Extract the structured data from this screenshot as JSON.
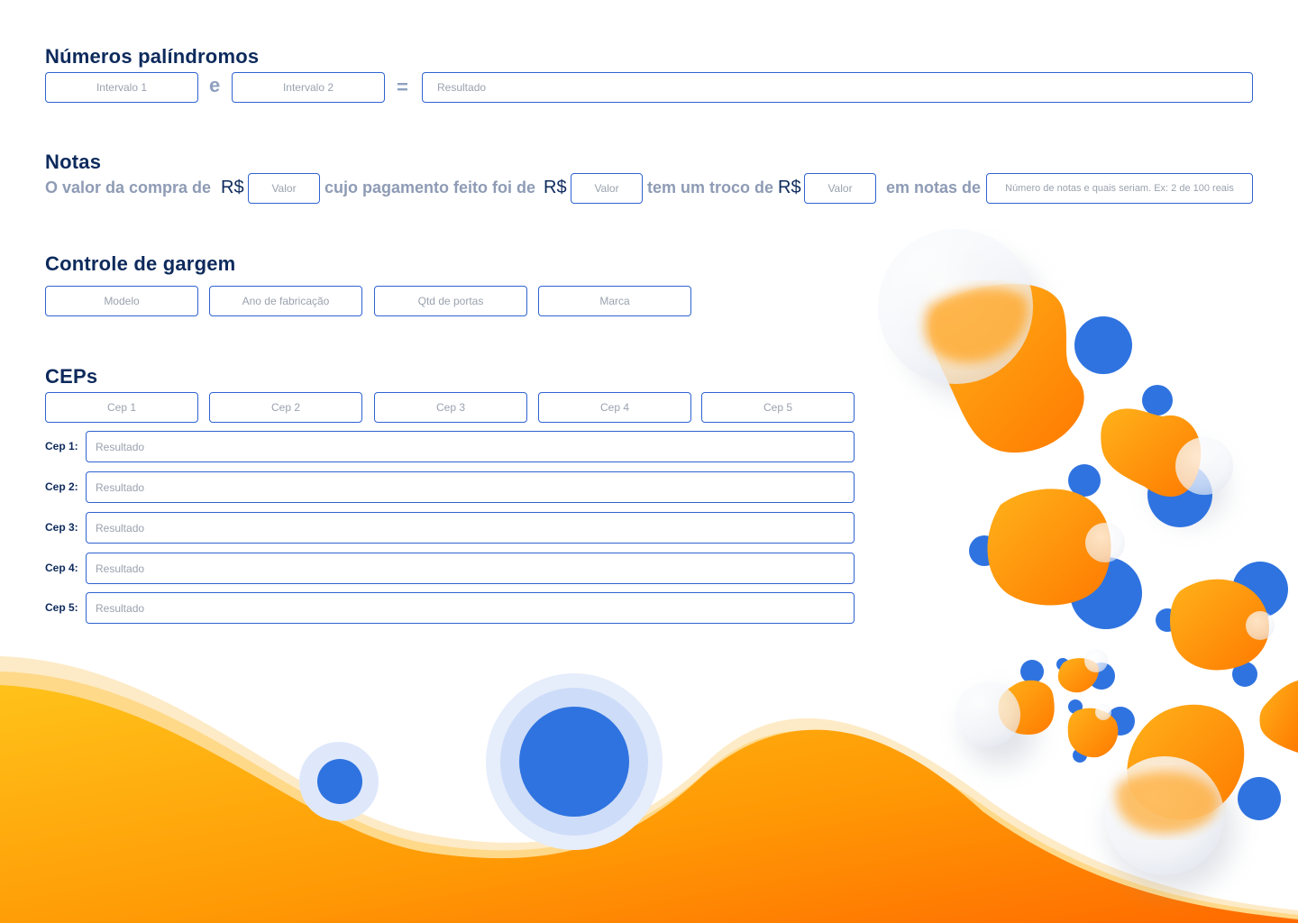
{
  "palindromos": {
    "title": "Números palíndromos",
    "interval1_placeholder": "Intervalo 1",
    "connector": "e",
    "interval2_placeholder": "Intervalo 2",
    "equals": "=",
    "result_placeholder": "Resultado"
  },
  "notas": {
    "title": "Notas",
    "text1": "O valor da compra de",
    "text2": "cujo pagamento feito foi de",
    "text3": "tem um troco de",
    "text4": "em notas de",
    "currency": "R$",
    "value_placeholder": "Valor",
    "notes_placeholder": "Número de notas e quais seriam. Ex: 2 de 100 reais"
  },
  "garagem": {
    "title": "Controle de gargem",
    "fields": [
      "Modelo",
      "Ano de fabricação",
      "Qtd de portas",
      "Marca"
    ]
  },
  "ceps": {
    "title": "CEPs",
    "inputs": [
      "Cep 1",
      "Cep 2",
      "Cep 3",
      "Cep 4",
      "Cep 5"
    ],
    "result_labels": [
      "Cep 1:",
      "Cep 2:",
      "Cep 3:",
      "Cep 4:",
      "Cep 5:"
    ],
    "result_placeholder": "Resultado"
  },
  "colors": {
    "primary": "#2f63d1",
    "title": "#0d2a5c",
    "orange": "#ff8c00",
    "yellow": "#ffc21a",
    "blue_circle": "#2f73e0"
  }
}
